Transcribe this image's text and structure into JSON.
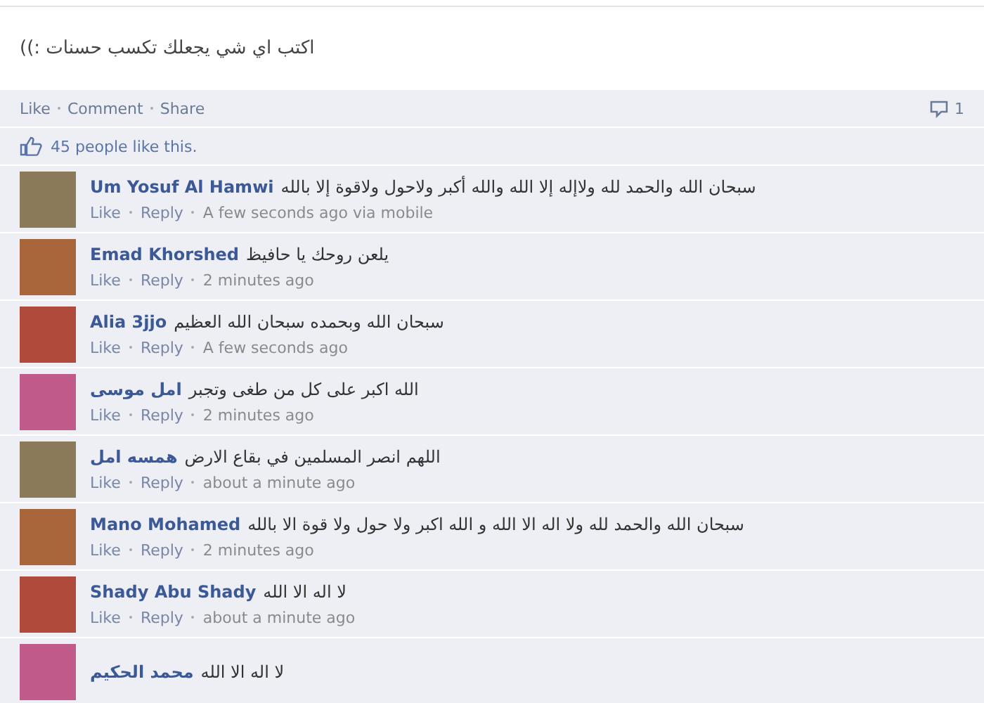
{
  "post": {
    "text": "اكتب اي شي يجعلك تكسب حسنات :))"
  },
  "actions": [
    "Like",
    "Comment",
    "Share"
  ],
  "comment_count": "1",
  "likes": "45 people like this.",
  "comments": [
    {
      "name": "Um Yosuf Al Hamwi",
      "text": "سبحان الله والحمد لله ولاإله إلا الله والله أكبر ولاحول ولاقوة إلا بالله",
      "links": [
        "Like",
        "Reply"
      ],
      "time": "A few seconds ago via mobile"
    },
    {
      "name": "Emad Khorshed",
      "text": "يلعن روحك يا حافيظ",
      "links": [
        "Like",
        "Reply"
      ],
      "time": "2 minutes ago"
    },
    {
      "name": "Alia 3jjo",
      "text": "سبحان الله وبحمده سبحان الله العظيم",
      "links": [
        "Like",
        "Reply"
      ],
      "time": "A few seconds ago"
    },
    {
      "name": "امل موسى",
      "text": "الله اكبر على كل من طغى وتجبر",
      "links": [
        "Like",
        "Reply"
      ],
      "time": "2 minutes ago"
    },
    {
      "name": "همسه امل",
      "text": "اللهم انصر المسلمين في بقاع الارض",
      "links": [
        "Like",
        "Reply"
      ],
      "time": "about a minute ago"
    },
    {
      "name": "Mano Mohamed",
      "text": "سبحان الله والحمد لله ولا اله الا الله و الله اكبر ولا حول ولا قوة الا بالله",
      "links": [
        "Like",
        "Reply"
      ],
      "time": "2 minutes ago"
    },
    {
      "name": "Shady Abu Shady",
      "text": "لا اله الا الله",
      "links": [
        "Like",
        "Reply"
      ],
      "time": "about a minute ago"
    },
    {
      "name": "محمد الحكيم",
      "text": "لا اله الا الله"
    }
  ]
}
